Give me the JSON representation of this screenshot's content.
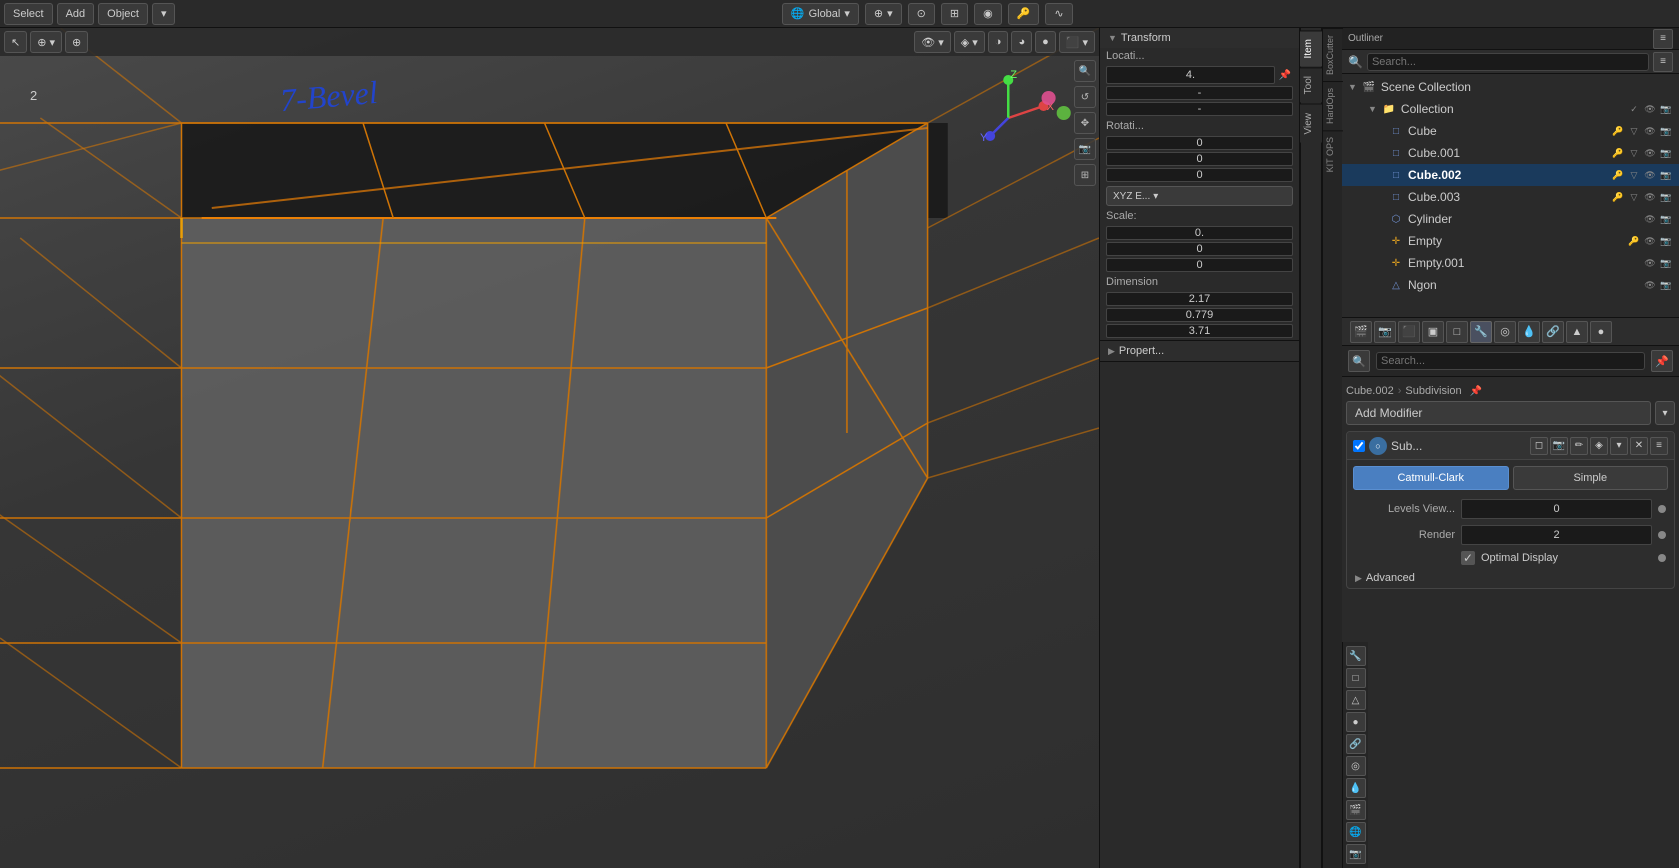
{
  "topbar": {
    "mode_label": "Global",
    "options_btn": "Options"
  },
  "viewport": {
    "handwriting": "7-Bevel",
    "select_btn": "Select",
    "add_btn": "Add",
    "object_btn": "Object",
    "num_2": "2"
  },
  "transform": {
    "header": "Transform",
    "location_label": "Locati...",
    "location_x": "4.",
    "location_y": "-",
    "location_z": "-",
    "rotation_label": "Rotati...",
    "rotation_x": "0",
    "rotation_y": "0",
    "rotation_z": "0",
    "xyz_mode": "XYZ E...",
    "scale_label": "Scale:",
    "scale_x": "0.",
    "scale_y": "0",
    "scale_z": "0",
    "dimensions_label": "Dimension",
    "dim_x": "2.17",
    "dim_y": "0.779",
    "dim_z": "3.71",
    "properties_label": "Propert..."
  },
  "sidetabs": {
    "item": "Item",
    "tool": "Tool",
    "view": "View"
  },
  "plugintabs": {
    "boxcutter": "BoxCutter",
    "hardops": "HardOps",
    "kitops": "KIT OPS"
  },
  "outliner": {
    "title": "Scene Collection",
    "search_placeholder": "Search...",
    "items": [
      {
        "name": "Scene Collection",
        "level": 0,
        "icon": "🎬",
        "type": "scene",
        "expanded": true
      },
      {
        "name": "Collection",
        "level": 1,
        "icon": "📁",
        "type": "collection",
        "expanded": true,
        "visible": true,
        "render": true
      },
      {
        "name": "Cube",
        "level": 2,
        "icon": "□",
        "type": "mesh",
        "active": false
      },
      {
        "name": "Cube.001",
        "level": 2,
        "icon": "□",
        "type": "mesh",
        "active": false
      },
      {
        "name": "Cube.002",
        "level": 2,
        "icon": "□",
        "type": "mesh",
        "active": true,
        "selected": true
      },
      {
        "name": "Cube.003",
        "level": 2,
        "icon": "□",
        "type": "mesh",
        "active": false
      },
      {
        "name": "Cylinder",
        "level": 2,
        "icon": "⬡",
        "type": "mesh",
        "active": false
      },
      {
        "name": "Empty",
        "level": 2,
        "icon": "✛",
        "type": "empty",
        "active": false
      },
      {
        "name": "Empty.001",
        "level": 2,
        "icon": "✛",
        "type": "empty",
        "active": false
      },
      {
        "name": "Ngon",
        "level": 2,
        "icon": "△",
        "type": "mesh",
        "active": false
      }
    ]
  },
  "properties": {
    "object_name": "Cube.002",
    "modifier_type": "Subdivision",
    "add_modifier_label": "Add Modifier",
    "modifier_name": "Sub...",
    "subdivision_types": [
      {
        "id": "catmull",
        "label": "Catmull-Clark",
        "active": true
      },
      {
        "id": "simple",
        "label": "Simple",
        "active": false
      }
    ],
    "levels_view_label": "Levels View...",
    "levels_view_value": "0",
    "render_label": "Render",
    "render_value": "2",
    "optimal_display_label": "Optimal Display",
    "optimal_display_checked": true,
    "advanced_label": "Advanced"
  },
  "icons": {
    "expand": "▶",
    "collapse": "▼",
    "chevron_right": "›",
    "close": "✕",
    "menu": "≡",
    "eye": "👁",
    "camera": "📷",
    "filter": "≡",
    "search": "🔍"
  }
}
